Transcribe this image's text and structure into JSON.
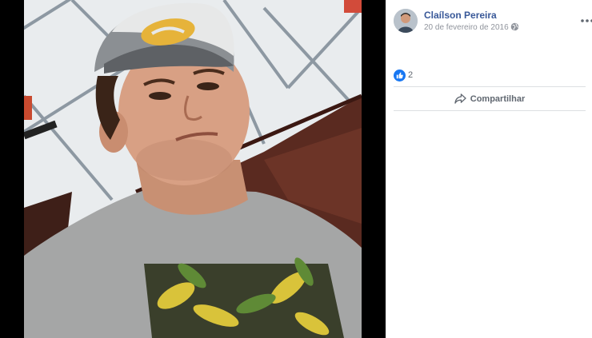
{
  "post": {
    "author_name": "Claílson Pereira",
    "date": "20 de fevereiro de 2016",
    "privacy_icon": "globe-icon",
    "options_icon": "more-options-icon"
  },
  "reactions": {
    "like_icon": "like-icon",
    "count": "2"
  },
  "actions": {
    "share_label": "Compartilhar",
    "share_icon": "share-icon"
  },
  "colors": {
    "author_link": "#385898",
    "muted_text": "#90949c",
    "like_blue": "#1877f2",
    "divider": "#dddfe2",
    "viewer_bg": "#000000"
  }
}
